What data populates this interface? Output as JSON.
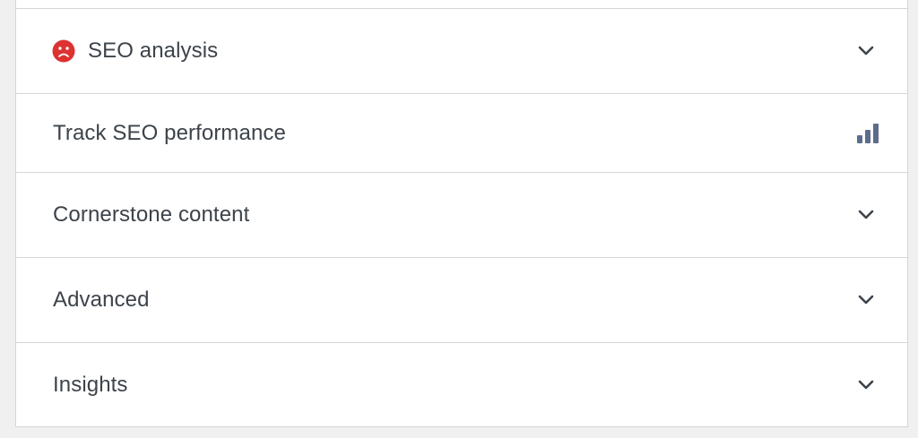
{
  "panel": {
    "rows": [
      {
        "label": "SEO analysis",
        "status": "bad",
        "status_color": "#dc3232",
        "icon": "chevron-down-icon"
      },
      {
        "label": "Track SEO performance",
        "icon": "bar-chart-icon"
      },
      {
        "label": "Cornerstone content",
        "icon": "chevron-down-icon"
      },
      {
        "label": "Advanced",
        "icon": "chevron-down-icon"
      },
      {
        "label": "Insights",
        "icon": "chevron-down-icon"
      }
    ]
  },
  "colors": {
    "text": "#3c434a",
    "border": "#d5d5d8",
    "page_background": "#f0f0f1",
    "panel_background": "#ffffff",
    "icon_muted": "#5d6c8b"
  }
}
